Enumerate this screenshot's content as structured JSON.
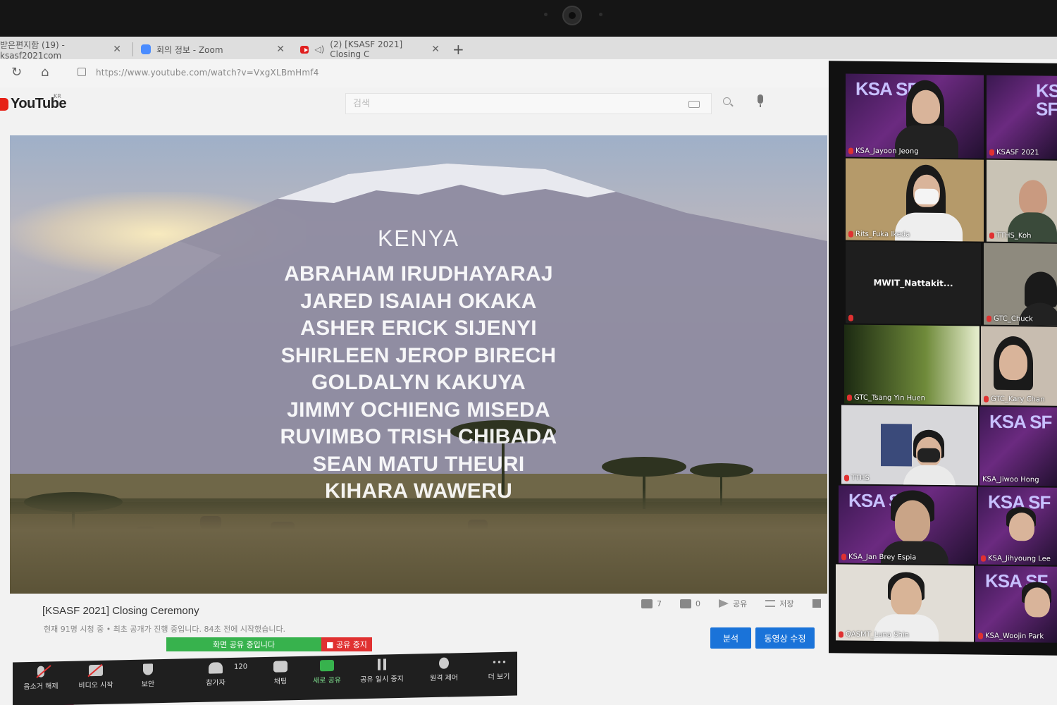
{
  "browser": {
    "tabs": [
      {
        "label": "받은편지함 (19) - ksasf2021com"
      },
      {
        "label": "회의 정보 - Zoom"
      },
      {
        "label": "(2) [KSASF 2021] Closing C"
      }
    ],
    "url": "https://www.youtube.com/watch?v=VxgXLBmHmf4"
  },
  "youtube": {
    "logo": "YouTube",
    "region": "KR",
    "search_placeholder": "검색",
    "video": {
      "country": "KENYA",
      "names": [
        "ABRAHAM IRUDHAYARAJ",
        "JARED ISAIAH OKAKA",
        "ASHER ERICK SIJENYI",
        "SHIRLEEN JEROP BIRECH",
        "GOLDALYN KAKUYA",
        "JIMMY OCHIENG MISEDA",
        "RUVIMBO TRISH CHIBADA",
        "SEAN MATU THEURI",
        "KIHARA WAWERU"
      ]
    },
    "title": "[KSASF 2021] Closing Ceremony",
    "meta": "현재 91명 시청 중 • 최초 공개가 진행 중입니다. 84초 전에 시작했습니다.",
    "likes": "7",
    "dislikes": "0",
    "share_label": "공유",
    "save_label": "저장",
    "analytics_button": "분석",
    "edit_button": "동영상 수정"
  },
  "zoom": {
    "sharing_banner": "화면 공유 중입니다",
    "stop_share": "■ 공유 중지",
    "toolbar": {
      "unmute": "음소거 해제",
      "start_video": "비디오 시작",
      "security": "보안",
      "participants": "참가자",
      "participant_count": "120",
      "chat": "채팅",
      "new_share": "새로 공유",
      "pause_share": "공유 일시 중지",
      "remote_control": "원격 제어",
      "more": "더 보기"
    },
    "gallery": [
      {
        "name": "KSA_Jayoon Jeong"
      },
      {
        "name": "KSASF 2021"
      },
      {
        "name": "Rits_Fuka Ikeda"
      },
      {
        "name": "TTHS_Koh"
      },
      {
        "name": "MWIT_Nattakit..."
      },
      {
        "name": "GTC_Chuck"
      },
      {
        "name": "GTC_Tsang Yin Huen"
      },
      {
        "name": "GTC_Kary Chan"
      },
      {
        "name": "TTHS"
      },
      {
        "name": "KSA_Jiwoo Hong"
      },
      {
        "name": "KSA_Jan Brey Espia"
      },
      {
        "name": "KSA_Jihyoung Lee"
      },
      {
        "name": "QASMT_Luna Shin"
      },
      {
        "name": "KSA_Woojin Park"
      }
    ],
    "tile_brand": "KSA SF",
    "colors": {
      "share_green": "#37b24d",
      "stop_red": "#e03131",
      "yt_blue": "#1a73d9"
    }
  }
}
